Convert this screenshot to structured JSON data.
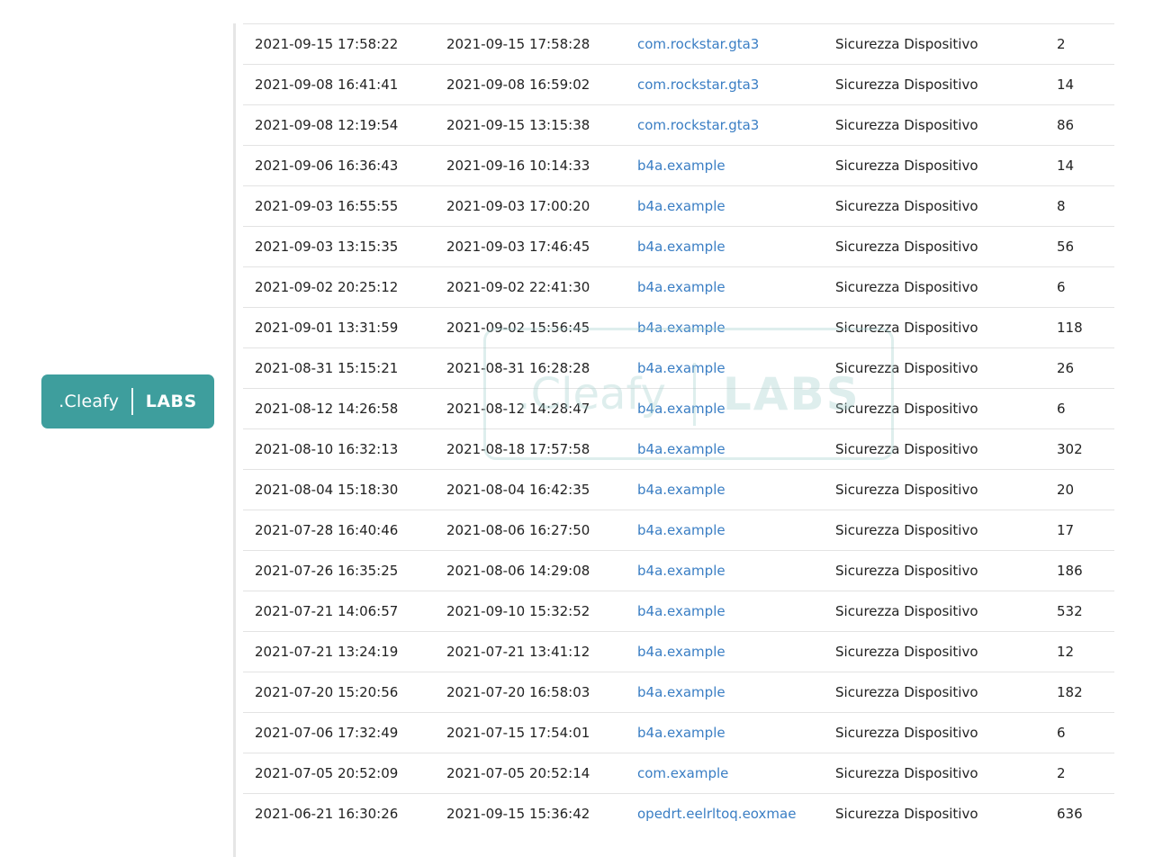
{
  "logo": {
    "brand": ".Cleafy",
    "labs": "LABS"
  },
  "watermark": {
    "brand": ".Cleafy",
    "labs": "LABS"
  },
  "colors": {
    "logo_background": "#3e9e9d",
    "link": "#3a7ec4"
  },
  "table": {
    "rows": [
      {
        "start": "2021-09-15 17:58:22",
        "end": "2021-09-15 17:58:28",
        "app": "com.rockstar.gta3",
        "category": "Sicurezza Dispositivo",
        "count": "2"
      },
      {
        "start": "2021-09-08 16:41:41",
        "end": "2021-09-08 16:59:02",
        "app": "com.rockstar.gta3",
        "category": "Sicurezza Dispositivo",
        "count": "14"
      },
      {
        "start": "2021-09-08 12:19:54",
        "end": "2021-09-15 13:15:38",
        "app": "com.rockstar.gta3",
        "category": "Sicurezza Dispositivo",
        "count": "86"
      },
      {
        "start": "2021-09-06 16:36:43",
        "end": "2021-09-16 10:14:33",
        "app": "b4a.example",
        "category": "Sicurezza Dispositivo",
        "count": "14"
      },
      {
        "start": "2021-09-03 16:55:55",
        "end": "2021-09-03 17:00:20",
        "app": "b4a.example",
        "category": "Sicurezza Dispositivo",
        "count": "8"
      },
      {
        "start": "2021-09-03 13:15:35",
        "end": "2021-09-03 17:46:45",
        "app": "b4a.example",
        "category": "Sicurezza Dispositivo",
        "count": "56"
      },
      {
        "start": "2021-09-02 20:25:12",
        "end": "2021-09-02 22:41:30",
        "app": "b4a.example",
        "category": "Sicurezza Dispositivo",
        "count": "6"
      },
      {
        "start": "2021-09-01 13:31:59",
        "end": "2021-09-02 15:56:45",
        "app": "b4a.example",
        "category": "Sicurezza Dispositivo",
        "count": "118"
      },
      {
        "start": "2021-08-31 15:15:21",
        "end": "2021-08-31 16:28:28",
        "app": "b4a.example",
        "category": "Sicurezza Dispositivo",
        "count": "26"
      },
      {
        "start": "2021-08-12 14:26:58",
        "end": "2021-08-12 14:28:47",
        "app": "b4a.example",
        "category": "Sicurezza Dispositivo",
        "count": "6"
      },
      {
        "start": "2021-08-10 16:32:13",
        "end": "2021-08-18 17:57:58",
        "app": "b4a.example",
        "category": "Sicurezza Dispositivo",
        "count": "302"
      },
      {
        "start": "2021-08-04 15:18:30",
        "end": "2021-08-04 16:42:35",
        "app": "b4a.example",
        "category": "Sicurezza Dispositivo",
        "count": "20"
      },
      {
        "start": "2021-07-28 16:40:46",
        "end": "2021-08-06 16:27:50",
        "app": "b4a.example",
        "category": "Sicurezza Dispositivo",
        "count": "17"
      },
      {
        "start": "2021-07-26 16:35:25",
        "end": "2021-08-06 14:29:08",
        "app": "b4a.example",
        "category": "Sicurezza Dispositivo",
        "count": "186"
      },
      {
        "start": "2021-07-21 14:06:57",
        "end": "2021-09-10 15:32:52",
        "app": "b4a.example",
        "category": "Sicurezza Dispositivo",
        "count": "532"
      },
      {
        "start": "2021-07-21 13:24:19",
        "end": "2021-07-21 13:41:12",
        "app": "b4a.example",
        "category": "Sicurezza Dispositivo",
        "count": "12"
      },
      {
        "start": "2021-07-20 15:20:56",
        "end": "2021-07-20 16:58:03",
        "app": "b4a.example",
        "category": "Sicurezza Dispositivo",
        "count": "182"
      },
      {
        "start": "2021-07-06 17:32:49",
        "end": "2021-07-15 17:54:01",
        "app": "b4a.example",
        "category": "Sicurezza Dispositivo",
        "count": "6"
      },
      {
        "start": "2021-07-05 20:52:09",
        "end": "2021-07-05 20:52:14",
        "app": "com.example",
        "category": "Sicurezza Dispositivo",
        "count": "2"
      },
      {
        "start": "2021-06-21 16:30:26",
        "end": "2021-09-15 15:36:42",
        "app": "opedrt.eelrltoq.eoxmae",
        "category": "Sicurezza Dispositivo",
        "count": "636"
      }
    ]
  }
}
